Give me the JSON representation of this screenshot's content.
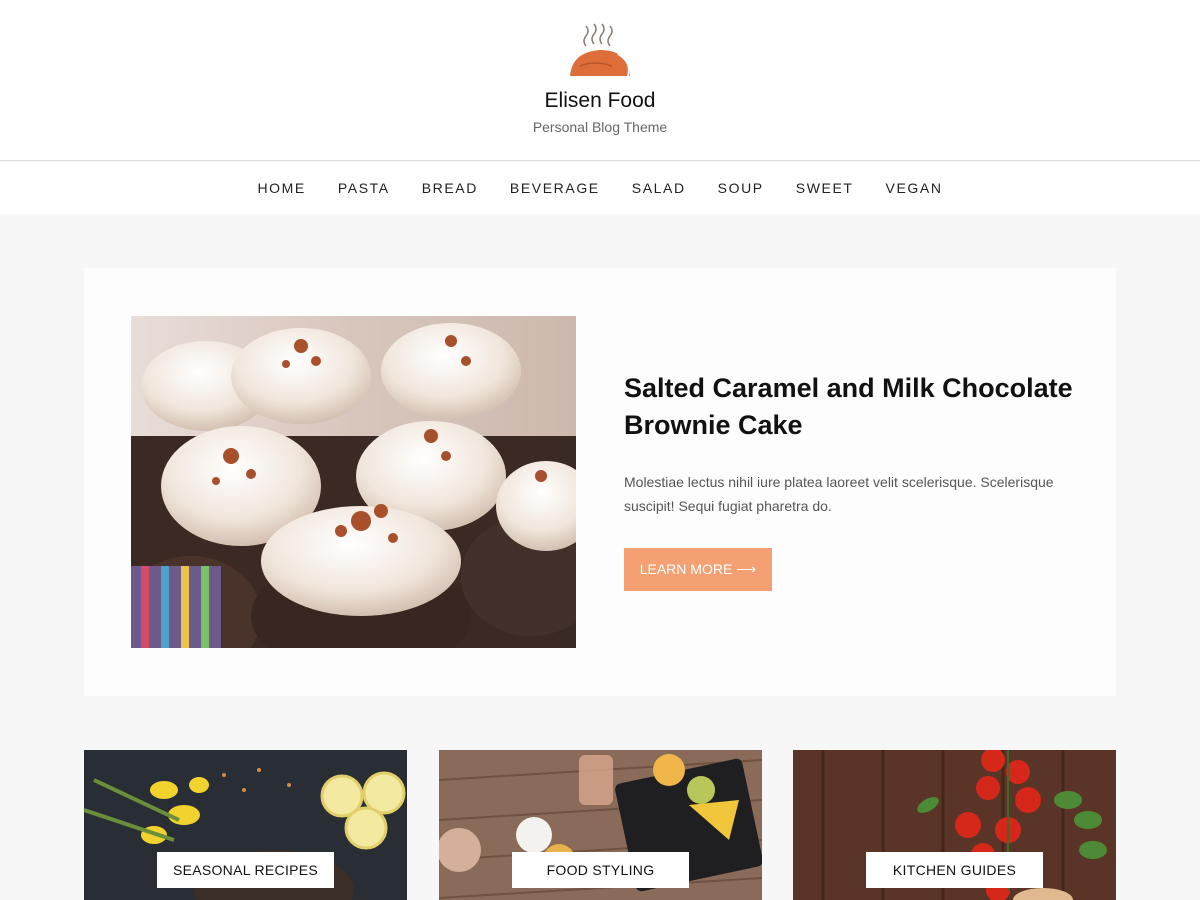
{
  "site": {
    "title": "Elisen Food",
    "tagline": "Personal Blog Theme",
    "logo_icon": "steaming-food-logo-icon",
    "accent_color": "#f4a072"
  },
  "nav": {
    "items": [
      {
        "label": "HOME"
      },
      {
        "label": "PASTA"
      },
      {
        "label": "BREAD"
      },
      {
        "label": "BEVERAGE"
      },
      {
        "label": "SALAD"
      },
      {
        "label": "SOUP"
      },
      {
        "label": "SWEET"
      },
      {
        "label": "VEGAN"
      }
    ]
  },
  "featured": {
    "title": "Salted Caramel and Milk Chocolate Brownie Cake",
    "excerpt": "Molestiae lectus nihil iure platea laoreet velit scelerisque. Scelerisque suscipit! Sequi fugiat pharetra do.",
    "button_label": "LEARN MORE ⟶"
  },
  "categories": [
    {
      "label": "SEASONAL RECIPES"
    },
    {
      "label": "FOOD STYLING"
    },
    {
      "label": "KITCHEN GUIDES"
    }
  ]
}
